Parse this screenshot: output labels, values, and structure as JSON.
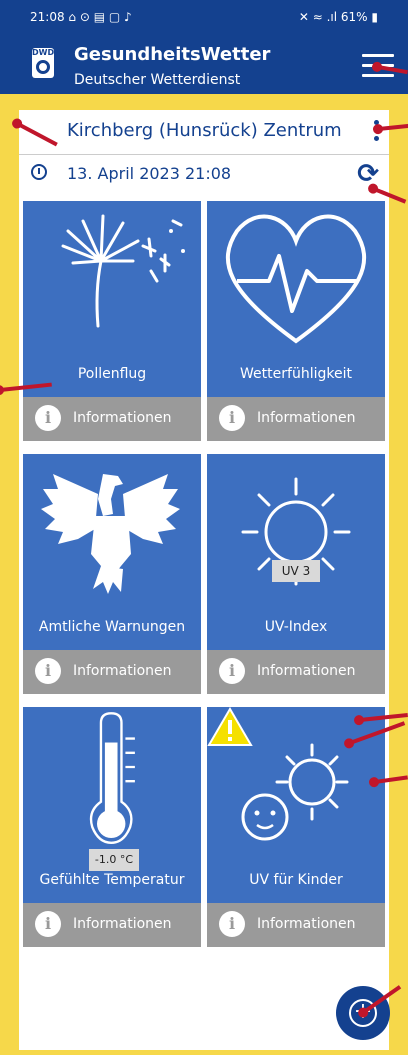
{
  "status_bar": {
    "time_icons": "21:08 ⌂ ⊙ ▤ ▢ ♪",
    "right": "✕ ≈ .ıl 61% ▮"
  },
  "appbar": {
    "title": "GesundheitsWetter",
    "subtitle": "Deutscher Wetterdienst",
    "logo_text": "DWD"
  },
  "location": {
    "name": "Kirchberg (Hunsrück) Zentrum"
  },
  "datetime": "13. April 2023 21:08",
  "tiles": [
    {
      "label": "Pollenflug",
      "info": "Informationen"
    },
    {
      "label": "Wetterfühligkeit",
      "info": "Informationen"
    },
    {
      "label": "Amtliche Warnungen",
      "info": "Informationen"
    },
    {
      "label": "UV-Index",
      "info": "Informationen",
      "badge": "UV 3"
    },
    {
      "label": "Gefühlte Temperatur",
      "info": "Informationen",
      "badge": "-1.0 °C"
    },
    {
      "label": "UV für Kinder",
      "info": "Informationen"
    }
  ],
  "colors": {
    "brand": "#14418f",
    "tile": "#3d6fc0",
    "info_bar": "#9a9a9a",
    "warning": "#f5e000",
    "annotation": "#c0162b",
    "border": "#f6d84a"
  },
  "icons": {
    "menu": "hamburger-icon",
    "more": "kebab-menu-icon",
    "refresh": "refresh-icon",
    "clock": "clock-icon",
    "add": "add-circle-icon"
  }
}
